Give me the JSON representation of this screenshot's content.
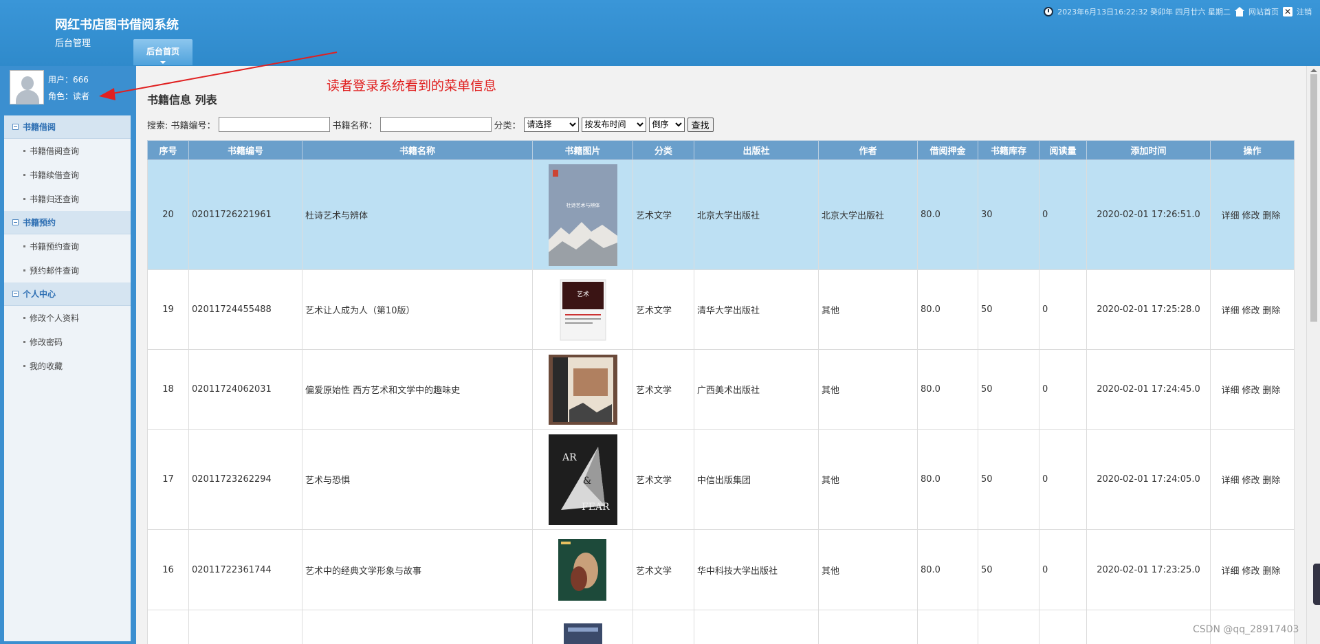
{
  "header": {
    "system_title": "网红书店图书借阅系统",
    "subtitle": "后台管理",
    "home_tab": "后台首页",
    "datetime": "2023年6月13日16:22:32 癸卯年 四月廿六 星期二",
    "site_home": "网站首页",
    "logout": "注销"
  },
  "user": {
    "name_line": "用户：666",
    "role_line": "角色：读者"
  },
  "menu": {
    "groups": [
      {
        "label": "书籍借阅",
        "items": [
          "书籍借阅查询",
          "书籍续借查询",
          "书籍归还查询"
        ]
      },
      {
        "label": "书籍预约",
        "items": [
          "书籍预约查询",
          "预约邮件查询"
        ]
      },
      {
        "label": "个人中心",
        "items": [
          "修改个人资料",
          "修改密码",
          "我的收藏"
        ]
      }
    ]
  },
  "annotation": "读者登录系统看到的菜单信息",
  "page_title": "书籍信息 列表",
  "search": {
    "label_prefix": "搜索: 书籍编号：",
    "name_label": "书籍名称：",
    "category_label": "分类：",
    "code_value": "",
    "name_value": "",
    "category_selected": "请选择",
    "sort_field_selected": "按发布时间",
    "order_selected": "倒序",
    "button": "查找"
  },
  "table": {
    "columns": [
      "序号",
      "书籍编号",
      "书籍名称",
      "书籍图片",
      "分类",
      "出版社",
      "作者",
      "借阅押金",
      "书籍库存",
      "阅读量",
      "添加时间",
      "操作"
    ],
    "actions": [
      "详细",
      "修改",
      "删除"
    ],
    "rows": [
      {
        "no": "20",
        "code": "02011726221961",
        "name": "杜诗艺术与辨体",
        "category": "艺术文学",
        "publisher": "北京大学出版社",
        "author": "北京大学出版社",
        "deposit": "80.0",
        "stock": "30",
        "reads": "0",
        "added": "2020-02-01 17:26:51.0"
      },
      {
        "no": "19",
        "code": "02011724455488",
        "name": "艺术让人成为人（第10版）",
        "category": "艺术文学",
        "publisher": "清华大学出版社",
        "author": "其他",
        "deposit": "80.0",
        "stock": "50",
        "reads": "0",
        "added": "2020-02-01 17:25:28.0"
      },
      {
        "no": "18",
        "code": "02011724062031",
        "name": "偏爱原始性 西方艺术和文学中的趣味史",
        "category": "艺术文学",
        "publisher": "广西美术出版社",
        "author": "其他",
        "deposit": "80.0",
        "stock": "50",
        "reads": "0",
        "added": "2020-02-01 17:24:45.0"
      },
      {
        "no": "17",
        "code": "02011723262294",
        "name": "艺术与恐惧",
        "category": "艺术文学",
        "publisher": "中信出版集团",
        "author": "其他",
        "deposit": "80.0",
        "stock": "50",
        "reads": "0",
        "added": "2020-02-01 17:24:05.0"
      },
      {
        "no": "16",
        "code": "02011722361744",
        "name": "艺术中的经典文学形象与故事",
        "category": "艺术文学",
        "publisher": "华中科技大学出版社",
        "author": "其他",
        "deposit": "80.0",
        "stock": "50",
        "reads": "0",
        "added": "2020-02-01 17:23:25.0"
      }
    ]
  },
  "watermark": "CSDN @qq_28917403"
}
